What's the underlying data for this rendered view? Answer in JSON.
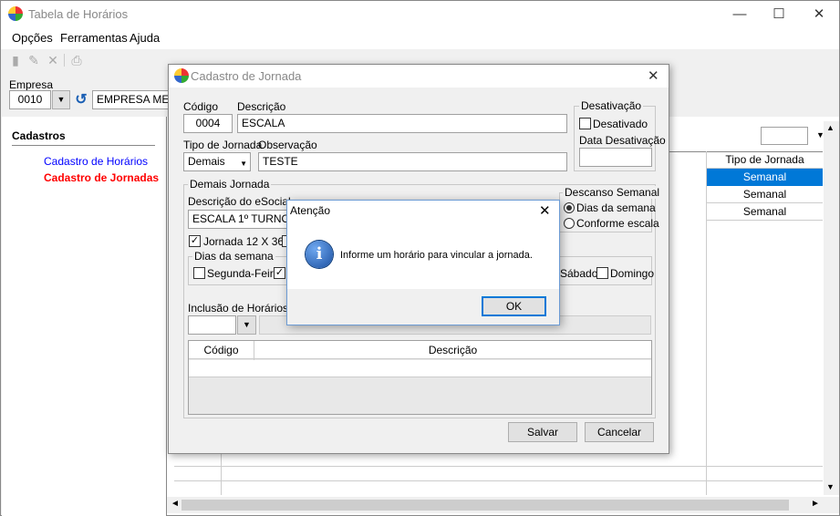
{
  "app": {
    "title": "Tabela de Horários",
    "window_controls": [
      "—",
      "☐",
      "✕"
    ]
  },
  "menu": {
    "opcoes": "Opções",
    "ferramentas": "Ferramentas",
    "ajuda": "Ajuda"
  },
  "toolbar": {
    "icons": [
      "new-icon",
      "edit-icon",
      "delete-icon",
      "print-icon"
    ]
  },
  "empresa": {
    "label": "Empresa",
    "code": "0010",
    "name": "EMPRESA MENSAL"
  },
  "sidebar": {
    "heading": "Cadastros",
    "items": [
      {
        "label": "Cadastro de Horários",
        "color": "#0000ff"
      },
      {
        "label": "Cadastro de Jornadas",
        "color": "#ff0000"
      }
    ]
  },
  "grid": {
    "column_tipo": "Tipo de Jornada",
    "rows": [
      "Semanal",
      "Semanal",
      "Semanal"
    ],
    "selected_color": "#0078d7"
  },
  "dialog": {
    "title": "Cadastro de Jornada",
    "close": "✕",
    "codigo_label": "Código",
    "codigo_value": "0004",
    "descricao_label": "Descrição",
    "descricao_value": "ESCALA",
    "tipo_label": "Tipo de Jornada",
    "tipo_value": "Demais",
    "observacao_label": "Observação",
    "observacao_value": "TESTE",
    "desativacao": {
      "group": "Desativação",
      "checkbox": "Desativado",
      "data_label": "Data Desativação"
    },
    "demais": {
      "group": "Demais Jornada",
      "esocial_label": "Descrição do eSocial",
      "esocial_value": "ESCALA 1º TURNO",
      "jornada_12x36": "Jornada 12 X 36",
      "dias_group": "Dias da semana",
      "segunda": "Segunda-Feira",
      "sabado": "Sábado",
      "domingo": "Domingo"
    },
    "descanso": {
      "group": "Descanso Semanal",
      "opt1": "Dias da semana",
      "opt2": "Conforme escala"
    },
    "inclusao_label": "Inclusão de Horários",
    "table": {
      "col_codigo": "Código",
      "col_descricao": "Descrição"
    },
    "salvar": "Salvar",
    "cancelar": "Cancelar"
  },
  "alert": {
    "title": "Atenção",
    "close": "✕",
    "message": "Informe um horário para vincular a jornada.",
    "ok": "OK",
    "icon_glyph": "i"
  }
}
